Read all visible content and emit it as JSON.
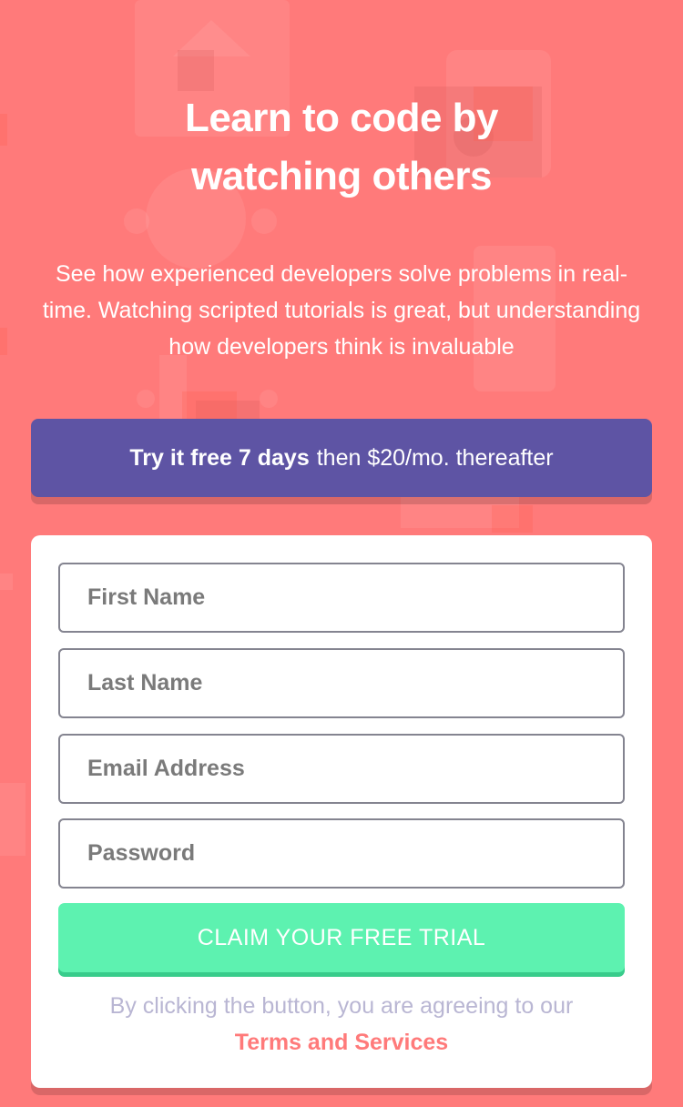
{
  "hero": {
    "title_line1": "Learn to code by",
    "title_line2": "watching others",
    "description": "See how experienced developers solve problems in real-time. Watching scripted tutorials is great, but understanding how developers think is invaluable"
  },
  "offer": {
    "bold": "Try it free 7 days",
    "rest": "then $20/mo. thereafter"
  },
  "form": {
    "first_name_placeholder": "First Name",
    "last_name_placeholder": "Last Name",
    "email_placeholder": "Email Address",
    "password_placeholder": "Password",
    "submit_label": "CLAIM YOUR FREE TRIAL",
    "legal_text": "By clicking the button, you are agreeing to our",
    "legal_link": "Terms and Services"
  },
  "colors": {
    "background": "#ff7a7a",
    "banner": "#5e54a4",
    "button": "#5df2b0",
    "button_shadow": "#38cc8b",
    "card": "#ffffff"
  }
}
